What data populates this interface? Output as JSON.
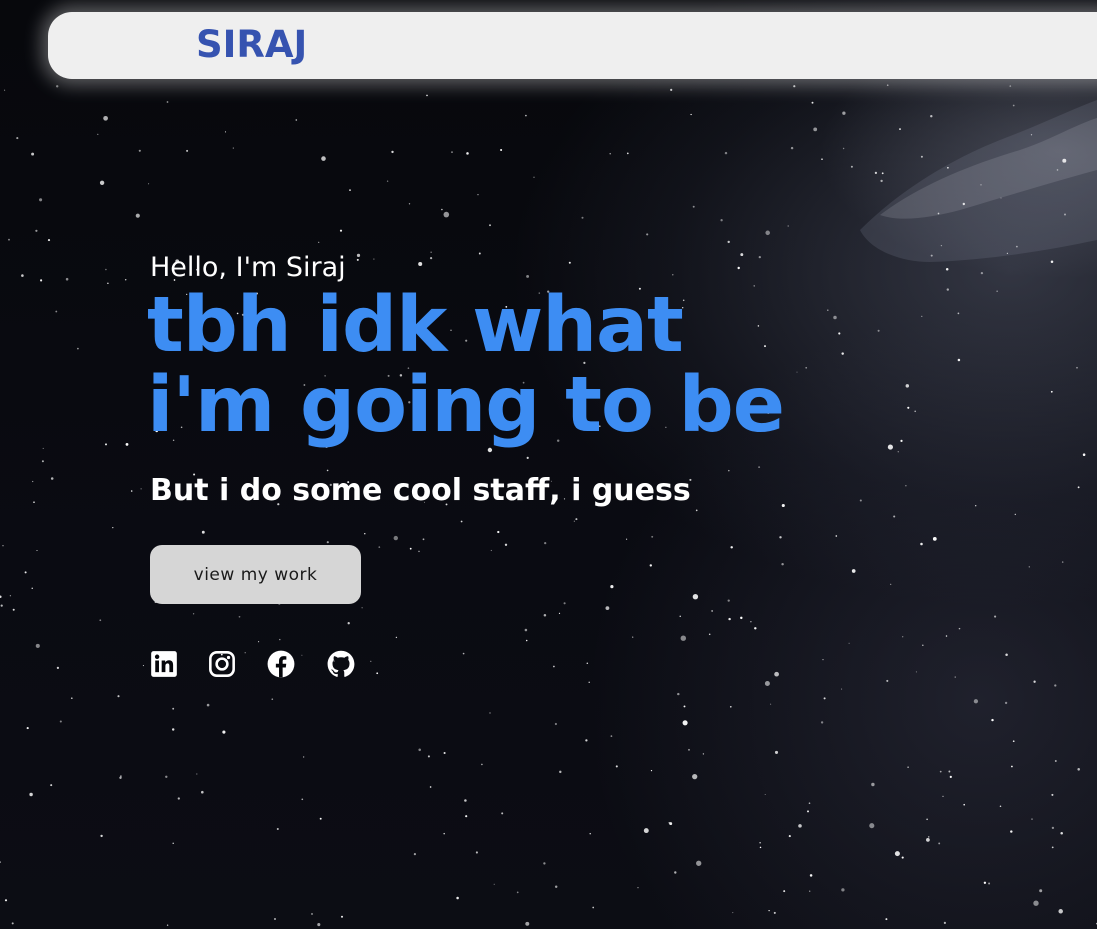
{
  "brand": {
    "logo_text": "SIRAJ",
    "accent_color": "#3d8df3",
    "logo_color": "#3653b0"
  },
  "hero": {
    "greeting": "Hello, I'm Siraj",
    "headline_line1": "tbh idk what",
    "headline_line2": "i'm going to be",
    "tagline": "But i do some cool staff, i guess",
    "cta_label": "view my work"
  },
  "socials": [
    {
      "icon": "linkedin-icon"
    },
    {
      "icon": "instagram-icon"
    },
    {
      "icon": "facebook-icon"
    },
    {
      "icon": "github-icon"
    }
  ]
}
